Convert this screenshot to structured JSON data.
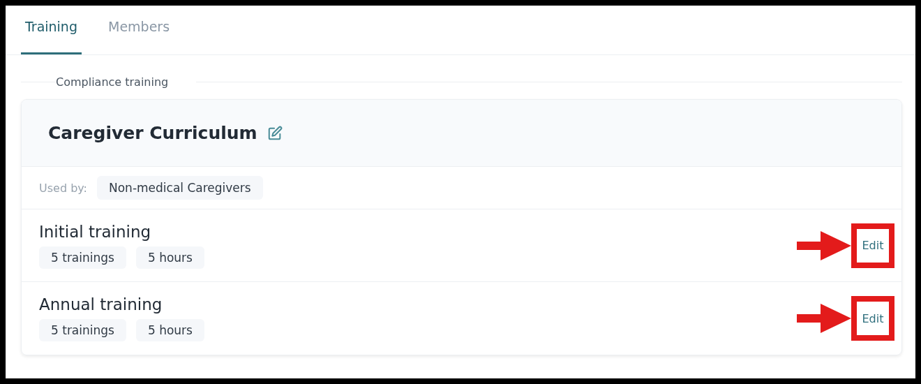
{
  "tabs": [
    {
      "label": "Training",
      "selected": true
    },
    {
      "label": "Members",
      "selected": false
    }
  ],
  "section": {
    "title": "Compliance training"
  },
  "curriculum": {
    "title": "Caregiver Curriculum",
    "used_by_label": "Used by:",
    "used_by": [
      "Non-medical Caregivers"
    ],
    "trainings": [
      {
        "title": "Initial training",
        "tags": [
          "5 trainings",
          "5 hours"
        ],
        "action": "Edit",
        "highlighted": true
      },
      {
        "title": "Annual training",
        "tags": [
          "5 trainings",
          "5 hours"
        ],
        "action": "Edit",
        "highlighted": true
      }
    ]
  }
}
